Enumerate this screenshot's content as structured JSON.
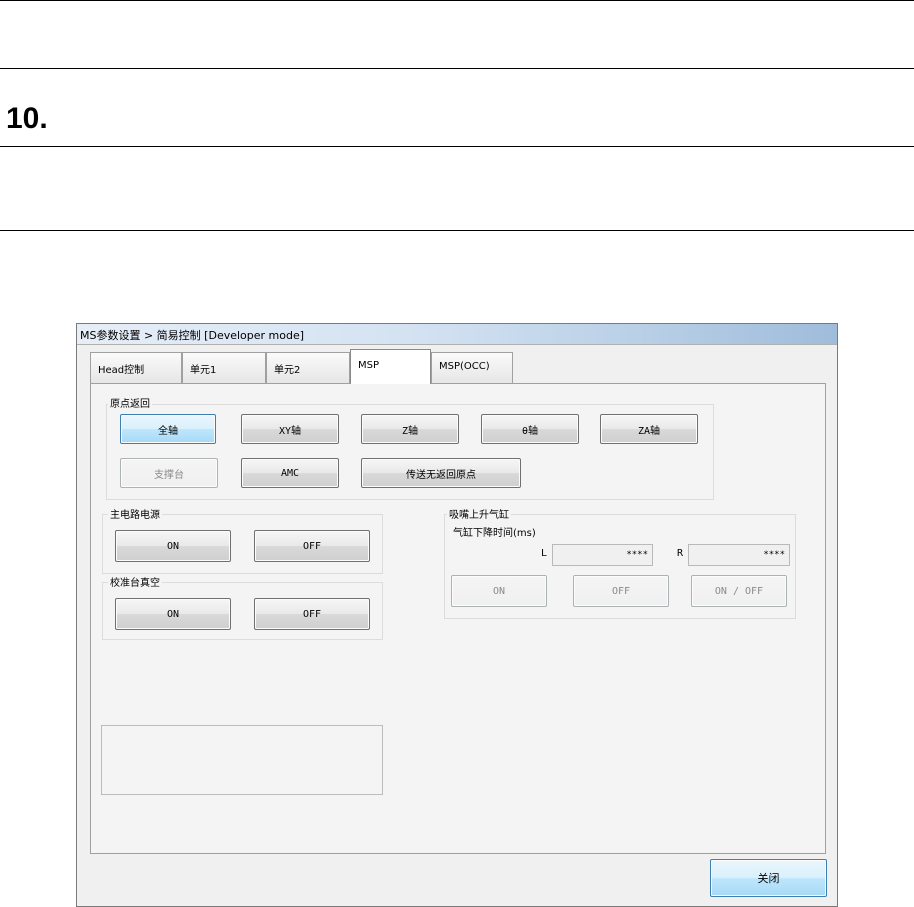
{
  "document": {
    "section_number": "10."
  },
  "window": {
    "title": "MS参数设置 > 简易控制 [Developer mode]",
    "tabs": [
      "Head控制",
      "单元1",
      "单元2",
      "MSP",
      "MSP(OCC)"
    ],
    "active_tab": "MSP"
  },
  "origin_return": {
    "label": "原点返回",
    "buttons": [
      "全轴",
      "XY轴",
      "Z轴",
      "θ轴",
      "ZA轴",
      "支撑台",
      "AMC",
      "传送无返回原点"
    ]
  },
  "main_power": {
    "label": "主电路电源",
    "on": "ON",
    "off": "OFF"
  },
  "calibration_vacuum": {
    "label": "校准台真空",
    "on": "ON",
    "off": "OFF"
  },
  "nozzle_cylinder": {
    "label": "吸嘴上升气缸",
    "sub_label": "气缸下降时间(ms)",
    "left_label": "L",
    "right_label": "R",
    "left_value": "****",
    "right_value": "****",
    "on": "ON",
    "off": "OFF",
    "on_off": "ON / OFF"
  },
  "footer": {
    "close": "关闭"
  }
}
